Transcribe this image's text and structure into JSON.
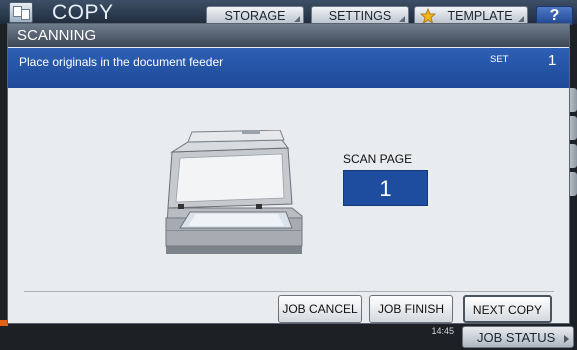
{
  "topbar": {
    "app_title": "COPY",
    "buttons": [
      {
        "label": "STORAGE"
      },
      {
        "label": "SETTINGS"
      },
      {
        "label": "TEMPLATE"
      }
    ],
    "help_label": "?"
  },
  "dialog": {
    "title": "SCANNING",
    "message": "Place originals in the document feeder",
    "set_label": "SET",
    "set_value": "1",
    "scan_page_label": "SCAN PAGE",
    "scan_page_value": "1"
  },
  "actions": {
    "job_cancel": "JOB CANCEL",
    "job_finish": "JOB FINISH",
    "next_copy": "NEXT COPY"
  },
  "footer": {
    "time": "14:45",
    "job_status": "JOB STATUS"
  },
  "icons": {
    "app": "copy-icon",
    "star": "star-icon",
    "help": "help-icon",
    "scanner": "scanner-illustration"
  }
}
